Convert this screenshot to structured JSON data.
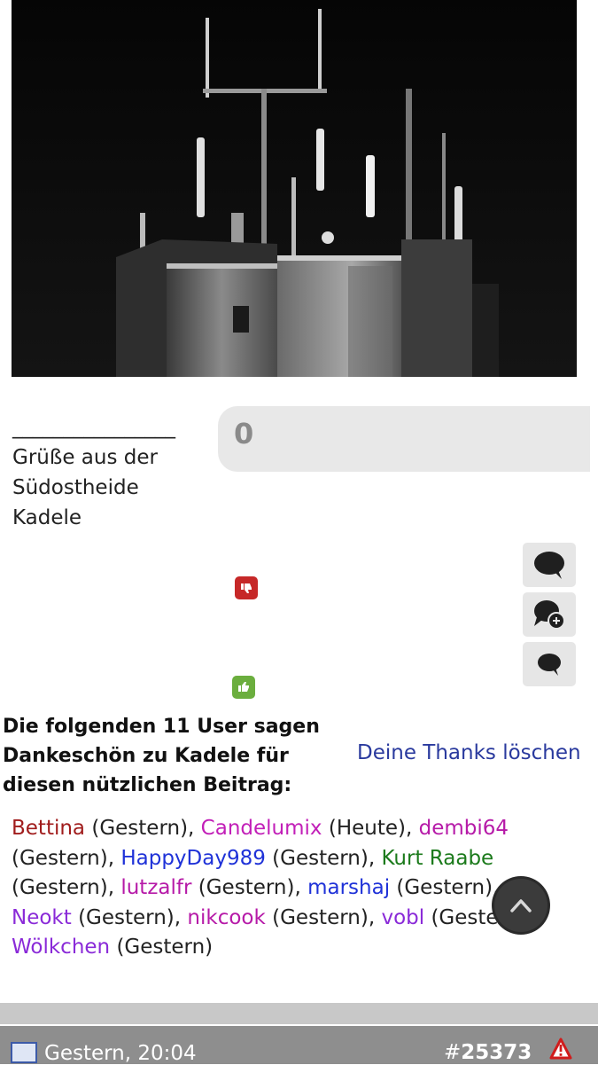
{
  "post": {
    "image_alt": "antenna-tower-photo",
    "signature": {
      "line": "________________",
      "text1": "Grüße aus der",
      "text2": "Südostheide",
      "text3": "Kadele"
    },
    "vote_count": "0"
  },
  "thanks": {
    "heading": "Die folgenden 11 User sagen Dankeschön zu Kadele für diesen nützlichen Beitrag:",
    "delete_label": "Deine Thanks löschen",
    "users": [
      {
        "name": "Bettina",
        "when": " (Gestern), ",
        "color": "#a01c1c"
      },
      {
        "name": "Candelumix",
        "when": " (Heute), ",
        "color": "#c21fb8"
      },
      {
        "name": "dembi64",
        "when": " (Gestern), ",
        "color": "#b61aa8"
      },
      {
        "name": "HappyDay989",
        "when": " (Gestern), ",
        "color": "#1f32d8"
      },
      {
        "name": "Kurt Raabe",
        "when": " (Gestern), ",
        "color": "#1b7a1b"
      },
      {
        "name": "lutzalfr",
        "when": " (Gestern), ",
        "color": "#b61aa8"
      },
      {
        "name": "marshaj",
        "when": " (Gestern), ",
        "color": "#1f32d8"
      },
      {
        "name": "Neokt",
        "when": " (Gestern), ",
        "color": "#8a2ad8"
      },
      {
        "name": "nikcook",
        "when": " (Gestern), ",
        "color": "#b61aa8"
      },
      {
        "name": "vobl",
        "when": " (Gestern), ",
        "color": "#8a2ad8"
      },
      {
        "name": "Wölkchen",
        "when": " (Gestern)",
        "color": "#8a2ad8"
      }
    ]
  },
  "next_post": {
    "date": "Gestern, 20:04",
    "number_prefix": "#",
    "number": "25373"
  },
  "icons": {
    "thumb_down": "thumbs-down-icon",
    "thumb_up": "thumbs-up-icon",
    "reply": "speech-bubble-icon",
    "quote": "quote-plus-icon",
    "quick_reply": "small-speech-bubble-icon",
    "scroll_top": "chevron-up-icon",
    "report": "warning-triangle-icon"
  }
}
